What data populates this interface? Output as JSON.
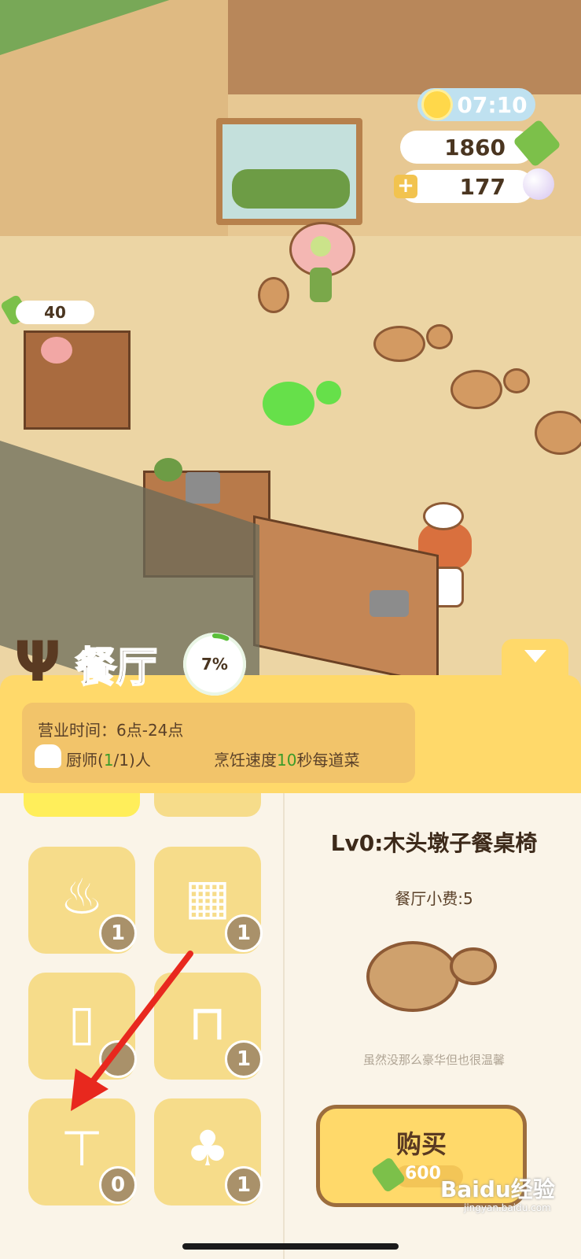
{
  "hud": {
    "time": "07:10",
    "bamboo": "1860",
    "pearls": "177",
    "plus": "+"
  },
  "scene": {
    "tip_value": "40"
  },
  "panel": {
    "title": "餐厅",
    "progress": "7%",
    "progress_value": 7,
    "hours": "营业时间：6点-24点",
    "chef_prefix": "厨师(",
    "chef_current": "1",
    "chef_suffix": "/1)人",
    "speed_prefix": "烹饪速度",
    "speed_value": "10",
    "speed_suffix": "秒每道菜"
  },
  "grid": [
    {
      "icon": "soup-bowl-icon",
      "glyph": "♨",
      "count": "1"
    },
    {
      "icon": "bookshelf-icon",
      "glyph": "▦",
      "count": "1"
    },
    {
      "icon": "fridge-icon",
      "glyph": "▯",
      "count": ""
    },
    {
      "icon": "bed-icon",
      "glyph": "⊓",
      "count": "1"
    },
    {
      "icon": "sink-icon",
      "glyph": "⊤",
      "count": "0"
    },
    {
      "icon": "potted-plant-icon",
      "glyph": "♣",
      "count": "1"
    }
  ],
  "detail": {
    "title": "Lv0:木头墩子餐桌椅",
    "tip": "餐厅小费:5",
    "description": "虽然没那么豪华但也很温馨",
    "buy_label": "购买",
    "price": "600"
  },
  "watermark": {
    "brand": "Baidu经验",
    "url": "jingyan.baidu.com"
  },
  "colors": {
    "panel_yellow": "#ffd96a",
    "arrow_red": "#e8281e",
    "text_brown": "#4a3520"
  }
}
